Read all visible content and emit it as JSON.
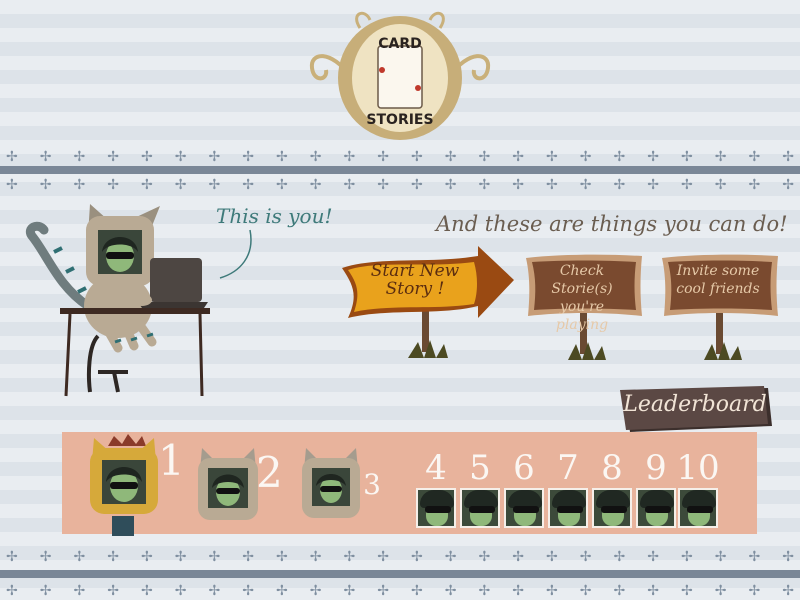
{
  "logo": {
    "line1": "CARD",
    "line2": "STORIES"
  },
  "intro": {
    "you_label": "This is you!",
    "things_label": "And these are things you can do!"
  },
  "actions": {
    "start_story": "Start New Story !",
    "check_stories_l1": "Check Storie(s)",
    "check_stories_l2": "you're playing",
    "invite_l1": "Invite some",
    "invite_l2": "cool friends"
  },
  "leaderboard": {
    "title": "Leaderboard",
    "ranks": [
      "1",
      "2",
      "3",
      "4",
      "5",
      "6",
      "7",
      "8",
      "9",
      "10"
    ]
  },
  "colors": {
    "start_sign": "#e9a21c",
    "check_sign": "#7a4a2f",
    "invite_sign": "#7a4a2f",
    "leaderboard_band": "#e8b39c",
    "leaderboard_banner": "#5b4844",
    "ornament": "#7f8fa0"
  }
}
